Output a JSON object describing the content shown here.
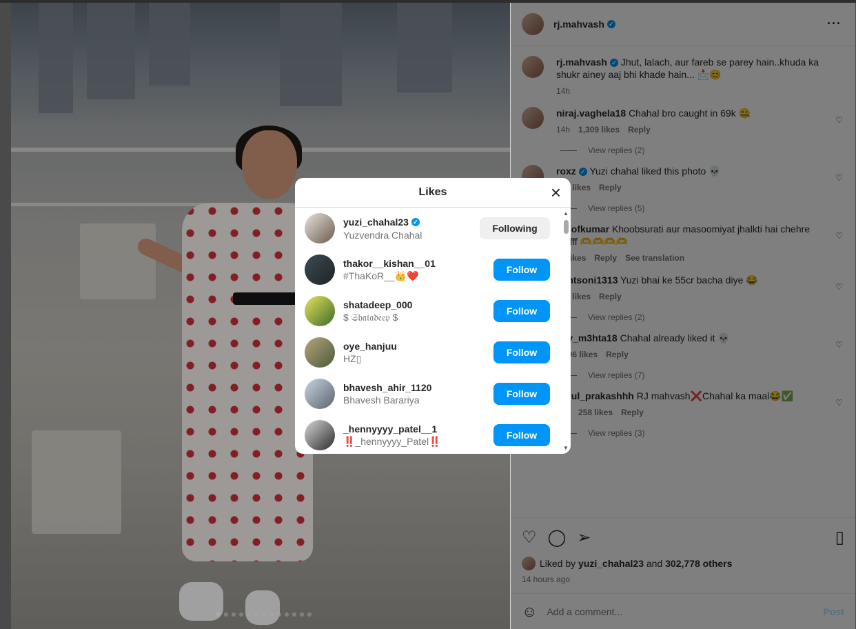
{
  "post": {
    "author": "rj.mahvash",
    "caption": "Jhut, lalach, aur fareb se parey hain..khuda ka shukr ainey aaj bhi khade hain... 📩😊",
    "caption_time": "14h",
    "liked_by_user": "yuzi_chahal23",
    "liked_by_others": "302,778 others",
    "liked_by_prefix": "Liked by",
    "liked_by_and": "and",
    "time_ago": "14 hours ago",
    "add_comment_placeholder": "Add a comment...",
    "post_label": "Post"
  },
  "comments": [
    {
      "user": "niraj.vaghela18",
      "text": "Chahal bro caught in 69k 🤐",
      "time": "14h",
      "likes": "1,309 likes",
      "reply": "Reply",
      "view_replies": "View replies (2)"
    },
    {
      "user": "roxz",
      "text": "Yuzi chahal liked this photo 💀",
      "time": "",
      "likes": "552 likes",
      "reply": "Reply",
      "view_replies": "View replies (5)"
    },
    {
      "user": "rdsofkumar",
      "text": "Khoobsurati aur masoomiyat jhalkti hai chehre ...ufff 🫶🫶🫶🫶",
      "time": "",
      "likes": "13 likes",
      "reply": "Reply",
      "translation": "See translation"
    },
    {
      "user": "hantsoni1313",
      "text": "Yuzi bhai ke 55cr bacha diye 😂",
      "time": "",
      "likes": "268 likes",
      "reply": "Reply",
      "view_replies": "View replies (2)"
    },
    {
      "user": "nay_m3hta18",
      "text": "Chahal already liked it 💀",
      "time": "",
      "likes": "3,006 likes",
      "reply": "Reply",
      "view_replies": "View replies (7)"
    },
    {
      "user": "rahul_prakashhh",
      "text": "RJ mahvash❌Chahal ka maal😂✅",
      "time": "13h",
      "likes": "258 likes",
      "reply": "Reply",
      "view_replies": "View replies (3)"
    }
  ],
  "likes_modal": {
    "title": "Likes",
    "close_icon": "×",
    "users": [
      {
        "username": "yuzi_chahal23",
        "verified": true,
        "full_name": "Yuzvendra Chahal",
        "button": "Following"
      },
      {
        "username": "thakor__kishan__01",
        "verified": false,
        "full_name": "#ThaKoR__👑❤️",
        "button": "Follow"
      },
      {
        "username": "shatadeep_000",
        "verified": false,
        "full_name": "$ 𝔖𝔥𝔞𝔱𝔞𝔡𝔢𝔢𝔭 $",
        "button": "Follow"
      },
      {
        "username": "oye_hanjuu",
        "verified": false,
        "full_name": "HZ▯",
        "button": "Follow"
      },
      {
        "username": "bhavesh_ahir_1120",
        "verified": false,
        "full_name": "Bhavesh Barariya",
        "button": "Follow"
      },
      {
        "username": "_hennyyyy_patel__1",
        "verified": false,
        "full_name": "‼️_hennyyyy_Patel‼️",
        "button": "Follow"
      }
    ]
  },
  "colors": {
    "accent": "#0095f6",
    "following_bg": "#efefef",
    "verified": "#0095f6"
  }
}
